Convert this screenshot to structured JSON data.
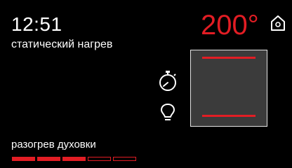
{
  "clock": {
    "time": "12:51"
  },
  "mode": {
    "label": "статический нагрев"
  },
  "temperature": {
    "value": "200°",
    "color": "#e21d24"
  },
  "icons": {
    "home": "home-icon",
    "timer": "timer-icon",
    "lamp": "lamp-icon"
  },
  "oven_diagram": {
    "top_heater_on": true,
    "bottom_heater_on": true
  },
  "preheat": {
    "label": "разогрев духовки",
    "segments_total": 5,
    "segments_filled": 3,
    "progress": 0.6
  }
}
